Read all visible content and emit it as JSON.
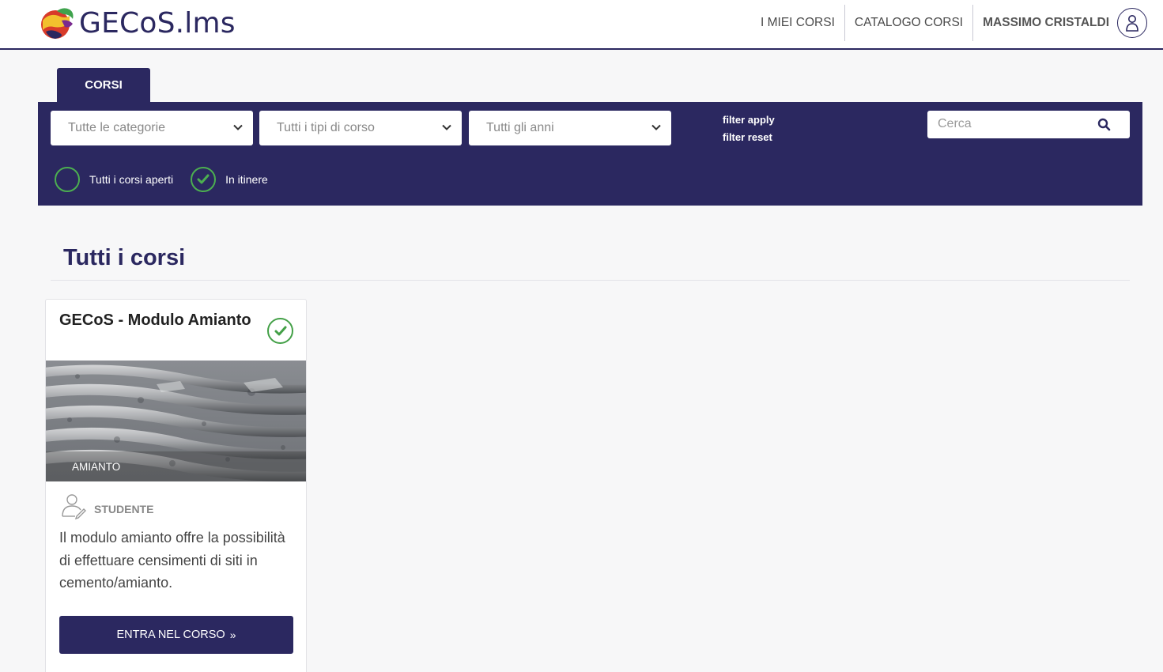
{
  "header": {
    "logo_text": "GECoS.lms",
    "nav": {
      "my_courses": "I MIEI CORSI",
      "catalog": "CATALOGO CORSI",
      "user_name": "MASSIMO CRISTALDI"
    }
  },
  "tabs": [
    {
      "label": "CORSI",
      "active": true
    }
  ],
  "filters": {
    "category": "Tutte le categorie",
    "course_type": "Tutti i tipi di corso",
    "year": "Tutti gli anni",
    "apply": "filter apply",
    "reset": "filter reset",
    "search_placeholder": "Cerca",
    "toggles": [
      {
        "label": "Tutti i corsi aperti",
        "checked": false
      },
      {
        "label": "In itinere",
        "checked": true
      }
    ]
  },
  "section": {
    "title": "Tutti i corsi"
  },
  "courses": [
    {
      "title": "GECoS - Modulo Amianto",
      "status": "in itinere",
      "image_label": "AMIANTO",
      "role": "STUDENTE",
      "description": "Il modulo amianto offre la possibilità di effettuare censimenti di siti in cemento/amianto.",
      "button": "ENTRA NEL CORSO"
    }
  ],
  "colors": {
    "primary": "#2b2860",
    "accent_green": "#43a047",
    "background": "#f7f7f8"
  }
}
